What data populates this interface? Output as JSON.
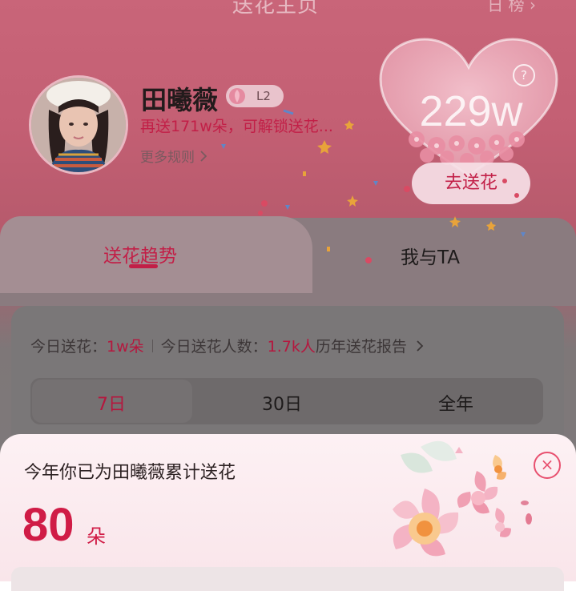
{
  "header": {
    "title": "送花主页",
    "right_text": "日  榜 ›"
  },
  "profile": {
    "name": "田曦薇",
    "level": "L2",
    "unlock_hint": "再送171w朵，可解锁送花...",
    "more_rules": "更多规则"
  },
  "heart": {
    "count": "229w",
    "send_label": "去送花",
    "help": "?"
  },
  "tabs": [
    {
      "label": "送花趋势",
      "active": true
    },
    {
      "label": "我与TA",
      "active": false
    }
  ],
  "stats": {
    "today_label": "今日送花：",
    "today_value": "1w朵",
    "people_label": "今日送花人数：",
    "people_value": "1.7k人",
    "report_label": "历年送花报告"
  },
  "ranges": [
    "7日",
    "30日",
    "全年"
  ],
  "popup": {
    "title": "今年你已为田曦薇累计送花",
    "count": "80",
    "unit": "朵",
    "close": "×"
  },
  "colors": {
    "accent": "#c21f47",
    "popup_bg": "#fdf1f4"
  },
  "icons": {
    "close": "close-icon",
    "help": "help-icon",
    "chevron": "chevron-right-icon"
  }
}
